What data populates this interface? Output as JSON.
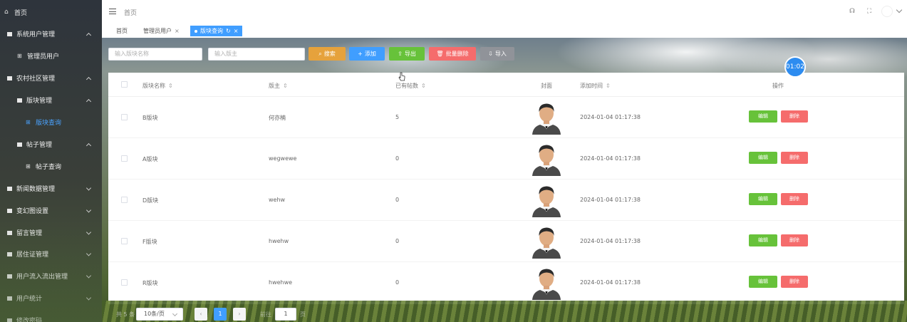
{
  "sidebar": {
    "items": [
      {
        "label": "首页",
        "icon": "home-icon",
        "level": 0
      },
      {
        "label": "系统用户管理",
        "icon": "menu-icon",
        "level": 0,
        "expanded": true
      },
      {
        "label": "管理员用户",
        "icon": "grid-icon",
        "level": 1
      },
      {
        "label": "农村社区管理",
        "icon": "menu-icon",
        "level": 0,
        "expanded": true
      },
      {
        "label": "版块管理",
        "icon": "menu-icon",
        "level": 1,
        "expanded": true
      },
      {
        "label": "版块查询",
        "icon": "grid-icon",
        "level": 2,
        "active": true
      },
      {
        "label": "帖子管理",
        "icon": "menu-icon",
        "level": 1,
        "expanded": true
      },
      {
        "label": "帖子查询",
        "icon": "grid-icon",
        "level": 2
      },
      {
        "label": "新闻数据管理",
        "icon": "menu-icon",
        "level": 0
      },
      {
        "label": "变幻图设置",
        "icon": "menu-icon",
        "level": 0
      },
      {
        "label": "留言管理",
        "icon": "menu-icon",
        "level": 0
      },
      {
        "label": "居住证管理",
        "icon": "menu-icon",
        "level": 0
      },
      {
        "label": "用户流入流出管理",
        "icon": "menu-icon",
        "level": 0
      },
      {
        "label": "用户统计",
        "icon": "menu-icon",
        "level": 0
      },
      {
        "label": "修改密码",
        "icon": "menu-icon",
        "level": 0
      }
    ]
  },
  "header": {
    "breadcrumb": "首页"
  },
  "tabs": [
    {
      "label": "首页",
      "closable": false
    },
    {
      "label": "管理员用户",
      "closable": true
    },
    {
      "label": "版块查询",
      "closable": true,
      "active": true
    }
  ],
  "toolbar": {
    "name_placeholder": "输入版块名称",
    "owner_placeholder": "输入版主",
    "search_label": "搜索",
    "add_label": "添加",
    "export_label": "导出",
    "batch_delete_label": "批量删除",
    "import_label": "导入"
  },
  "timer": "01:02",
  "table": {
    "headers": {
      "name": "版块名称",
      "owner": "版主",
      "posts": "已有帖数",
      "cover": "封面",
      "added": "添加时间",
      "ops": "操作"
    },
    "rows": [
      {
        "name": "B版块",
        "owner": "何亦楠",
        "posts": "5",
        "added": "2024-01-04 01:17:38"
      },
      {
        "name": "A版块",
        "owner": "wegwewe",
        "posts": "0",
        "added": "2024-01-04 01:17:38"
      },
      {
        "name": "D版块",
        "owner": "wehw",
        "posts": "0",
        "added": "2024-01-04 01:17:38"
      },
      {
        "name": "F版块",
        "owner": "hwehw",
        "posts": "0",
        "added": "2024-01-04 01:17:38"
      },
      {
        "name": "R版块",
        "owner": "hwehwe",
        "posts": "0",
        "added": "2024-01-04 01:17:38"
      }
    ],
    "edit_label": "编辑",
    "delete_label": "删除"
  },
  "pagination": {
    "total_label": "共 5 条",
    "page_size": "10条/页",
    "prev": "‹",
    "current_page": "1",
    "next": "›",
    "goto_label": "前往",
    "goto_value": "1",
    "page_suffix": "页"
  },
  "colors": {
    "primary": "#409eff",
    "search_btn": "#e6a23c",
    "add_btn": "#409eff",
    "export_btn": "#67c23a",
    "delete_btn": "#f56c6c",
    "import_btn": "#909399"
  }
}
